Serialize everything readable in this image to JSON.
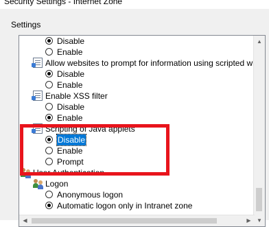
{
  "window": {
    "title": "Security Settings - Internet Zone"
  },
  "settings_group": {
    "label": "Settings"
  },
  "list": {
    "item_disable_1": "Disable",
    "item_enable_1": "Enable",
    "header_prompt_info": "Allow websites to prompt for information using scripted windo",
    "item_disable_2": "Disable",
    "item_enable_2": "Enable",
    "header_xss": "Enable XSS filter",
    "item_disable_3": "Disable",
    "item_enable_3": "Enable",
    "header_java": "Scripting of Java applets",
    "java_disable": "Disable",
    "java_enable": "Enable",
    "java_prompt": "Prompt",
    "header_user_auth": "User Authentication",
    "header_logon": "Logon",
    "logon_anonymous": "Anonymous logon",
    "logon_automatic": "Automatic logon only in Intranet zone"
  },
  "colors": {
    "highlight": "#e8141c",
    "selection": "#0078d7"
  },
  "icons": {
    "setting": "document-settings-icon",
    "users": "users-icon",
    "scroll_up": "chevron-up-icon",
    "scroll_down": "chevron-down-icon",
    "scroll_left": "chevron-left-icon",
    "scroll_right": "chevron-right-icon"
  }
}
